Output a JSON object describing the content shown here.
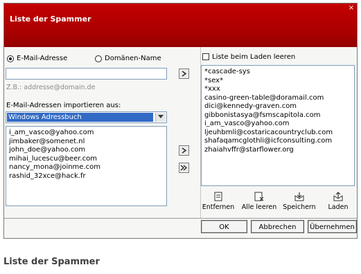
{
  "window": {
    "title": "Liste der Spammer",
    "close_glyph": "×"
  },
  "left": {
    "radio_email": "E-Mail-Adresse",
    "radio_domain": "Domänen-Name",
    "input_value": "",
    "hint": "Z.B.: addresse@domain.de",
    "import_label": "E-Mail-Adressen importieren aus:",
    "import_source": "Windows Adressbuch",
    "contacts": [
      "i_am_vasco@yahoo.com",
      "jimbaker@somenet.nl",
      "john_doe@yahoo.com",
      "mihai_lucescu@beer.com",
      "nancy_mona@joinme.com",
      "rashid_32xce@hack.fr"
    ]
  },
  "right": {
    "clear_on_load_label": "Liste beim Laden leeren",
    "spammers": [
      "*cascade-sys",
      "*sex*",
      "*xxx",
      "casino-green-table@doramail.com",
      "dici@kennedy-graven.com",
      "gibbonistasya@fsmscapitola.com",
      "i_am_vasco@yahoo.com",
      "ljeuhbmli@costaricacountryclub.com",
      "shafaqamcglothli@icfconsulting.com",
      "zhaiahvffr@starflower.org"
    ],
    "tools": {
      "remove": "Entfernen",
      "clear_all": "Alle leeren",
      "save": "Speichern",
      "load": "Laden"
    }
  },
  "footer": {
    "ok": "OK",
    "cancel": "Abbrechen",
    "apply": "Übernehmen"
  },
  "caption": "Liste der Spammer"
}
